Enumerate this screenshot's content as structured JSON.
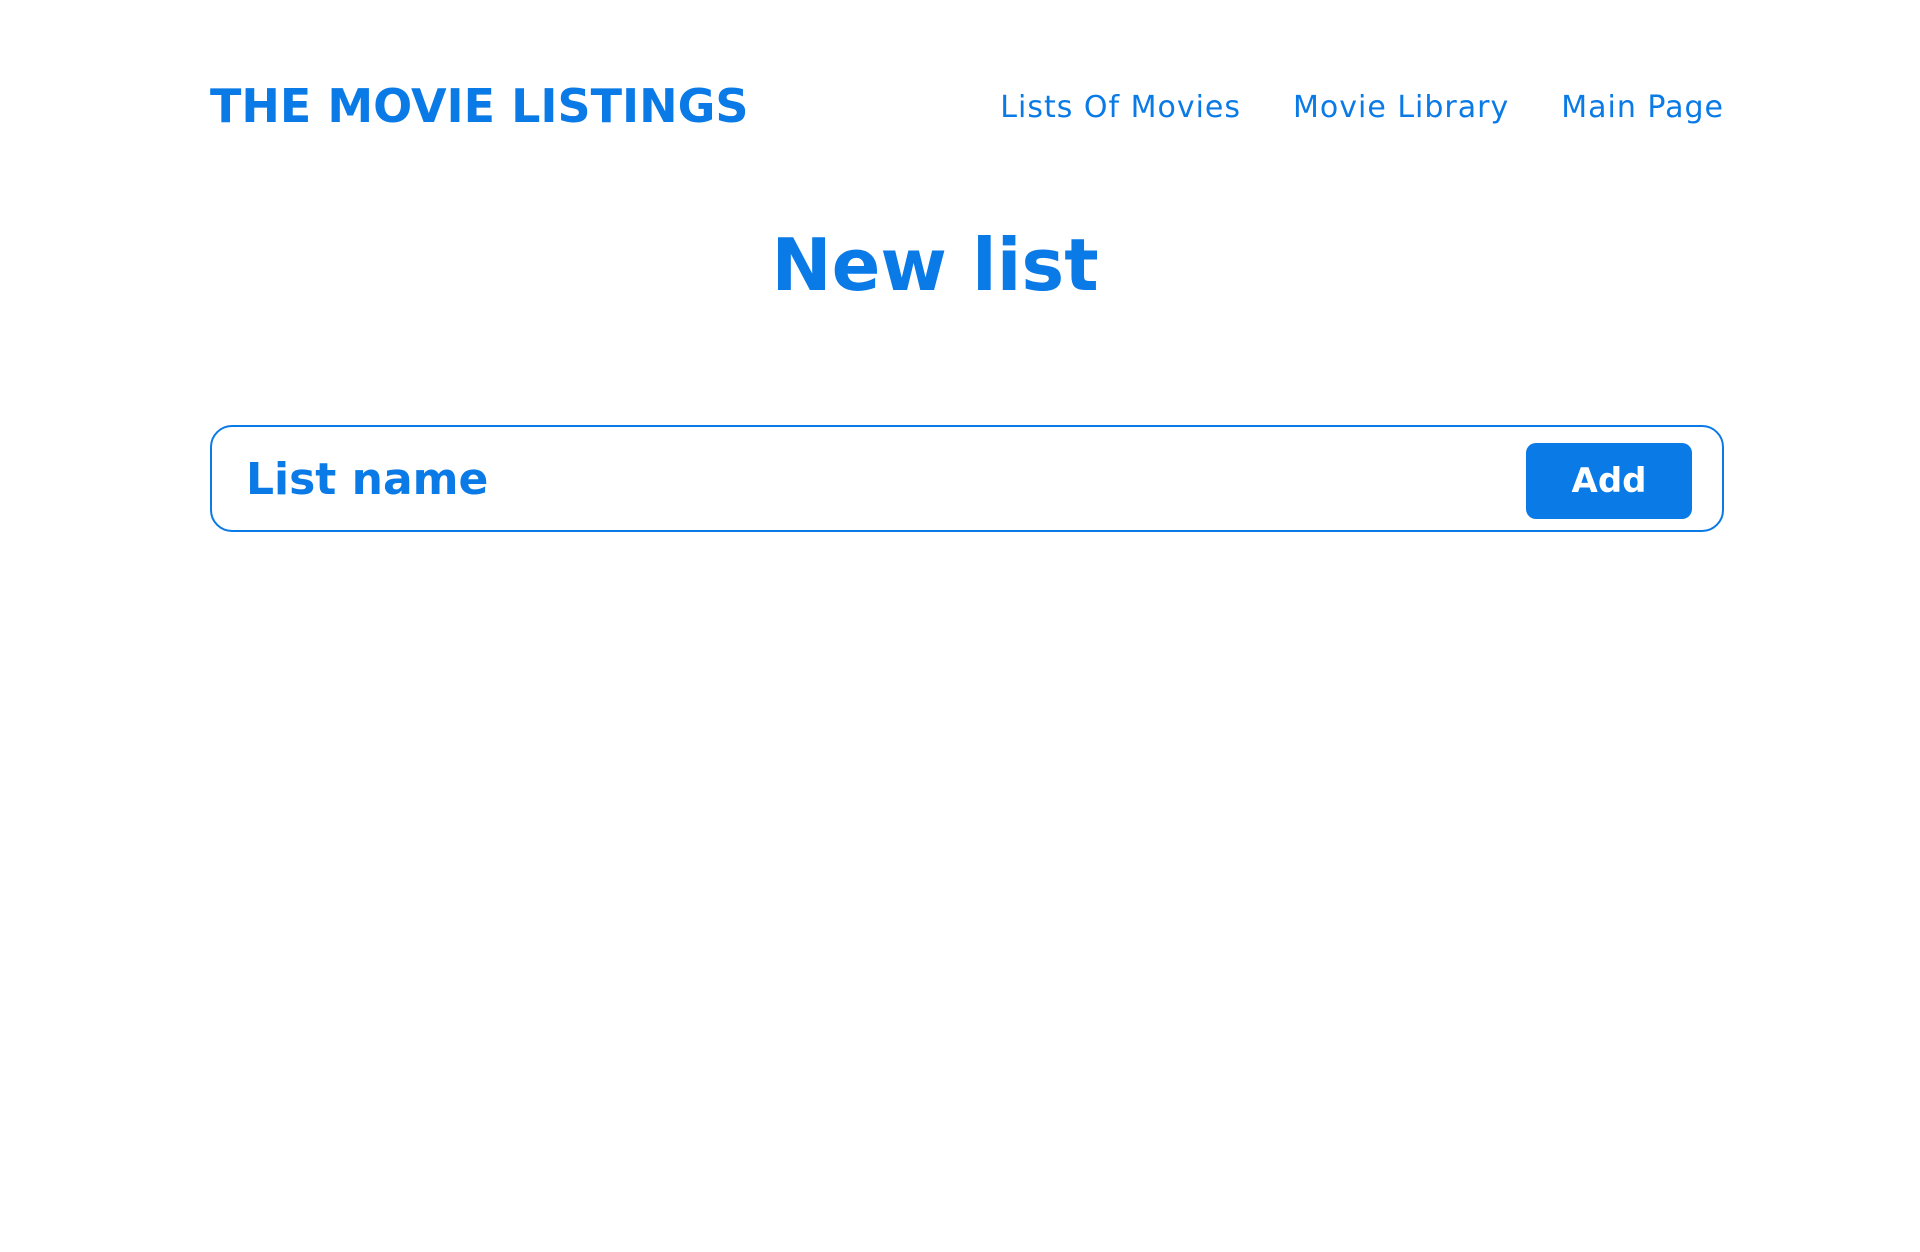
{
  "header": {
    "logo": "THE MOVIE LISTINGS",
    "nav": [
      {
        "label": "Lists Of Movies"
      },
      {
        "label": "Movie Library"
      },
      {
        "label": "Main Page"
      }
    ]
  },
  "page": {
    "title": "New list"
  },
  "form": {
    "list_name_placeholder": "List name",
    "list_name_value": "",
    "add_label": "Add"
  },
  "colors": {
    "accent": "#0a7ae6",
    "background": "#ffffff",
    "button_text": "#ffffff"
  }
}
